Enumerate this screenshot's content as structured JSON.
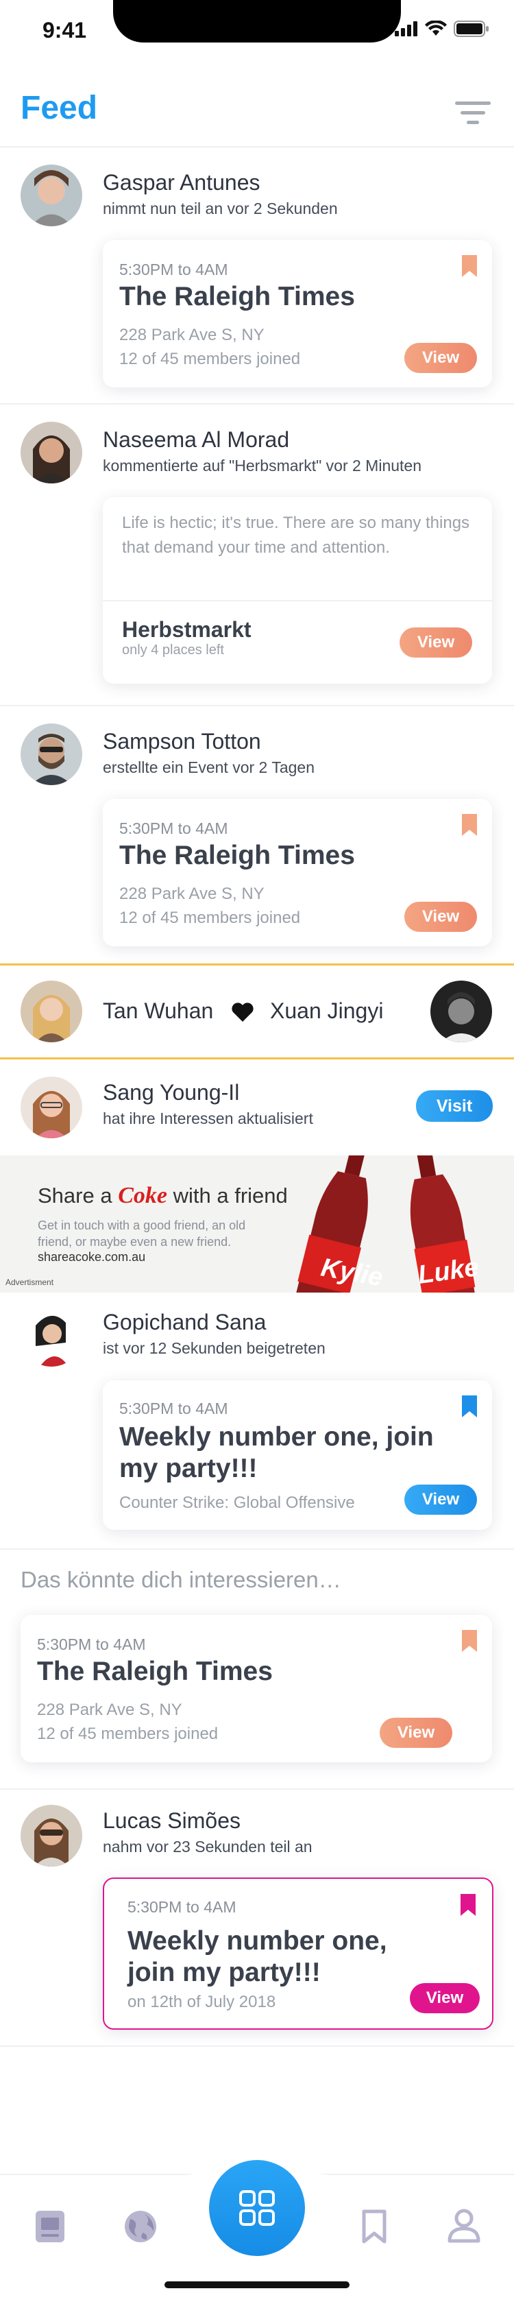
{
  "status": {
    "time": "9:41"
  },
  "header": {
    "title": "Feed"
  },
  "posts": [
    {
      "name": "Gaspar Antunes",
      "activity": "nimmt nun teil an vor 2 Sekunden",
      "card": {
        "time": "5:30PM to 4AM",
        "title": "The Raleigh Times",
        "address": "228 Park Ave S, NY",
        "members": "12 of 45 members joined",
        "button": "View"
      }
    },
    {
      "name": "Naseema Al Morad",
      "activity": "kommentierte auf \"Herbsmarkt\" vor 2 Minuten",
      "card": {
        "quote": "Life is hectic; it's true. There are so many things that demand your time and attention.",
        "title": "Herbstmarkt",
        "sub": "only 4 places left",
        "button": "View"
      }
    },
    {
      "name": "Sampson Totton",
      "activity": "erstellte ein Event vor 2 Tagen",
      "card": {
        "time": "5:30PM to 4AM",
        "title": "The Raleigh Times",
        "address": "228 Park Ave S, NY",
        "members": "12 of 45 members joined",
        "button": "View"
      }
    }
  ],
  "match": {
    "left_name": "Tan Wuhan",
    "right_name": "Xuan Jingyi"
  },
  "interests_update": {
    "name": "Sang Young-Il",
    "activity": "hat ihre Interessen aktualisiert",
    "button": "Visit"
  },
  "ad": {
    "headline_pre": "Share a",
    "brand": "Coke",
    "headline_post": "with a friend",
    "body": "Get in touch with a good friend, an old friend, or maybe even a new friend.",
    "url": "shareacoke.com.au",
    "label": "Advertisment",
    "bottle_left": "Kylie",
    "bottle_right": "Luke"
  },
  "post4": {
    "name": "Gopichand Sana",
    "activity": "ist vor 12 Sekunden beigetreten",
    "card": {
      "time": "5:30PM to 4AM",
      "title": "Weekly number one, join my party!!!",
      "game": "Counter Strike: Global Offensive",
      "button": "View"
    }
  },
  "suggestions": {
    "title": "Das könnte dich interessieren…",
    "card": {
      "time": "5:30PM to 4AM",
      "title": "The Raleigh Times",
      "address": "228 Park Ave S, NY",
      "members": "12 of 45 members joined",
      "button": "View"
    }
  },
  "post5": {
    "name": "Lucas Simões",
    "activity": "nahm vor 23 Sekunden teil an",
    "card": {
      "time": "5:30PM to 4AM",
      "title": "Weekly number one, join my party!!!",
      "date": "on 12th of July 2018",
      "button": "View"
    }
  },
  "colors": {
    "accent": "#1e9bf0",
    "orange": "#ef8a6e",
    "pink": "#e0158e",
    "gold": "#f3c24a"
  },
  "nav": {
    "icons": [
      "document-icon",
      "globe-icon",
      "grid-icon",
      "bookmark-icon",
      "profile-icon"
    ]
  }
}
